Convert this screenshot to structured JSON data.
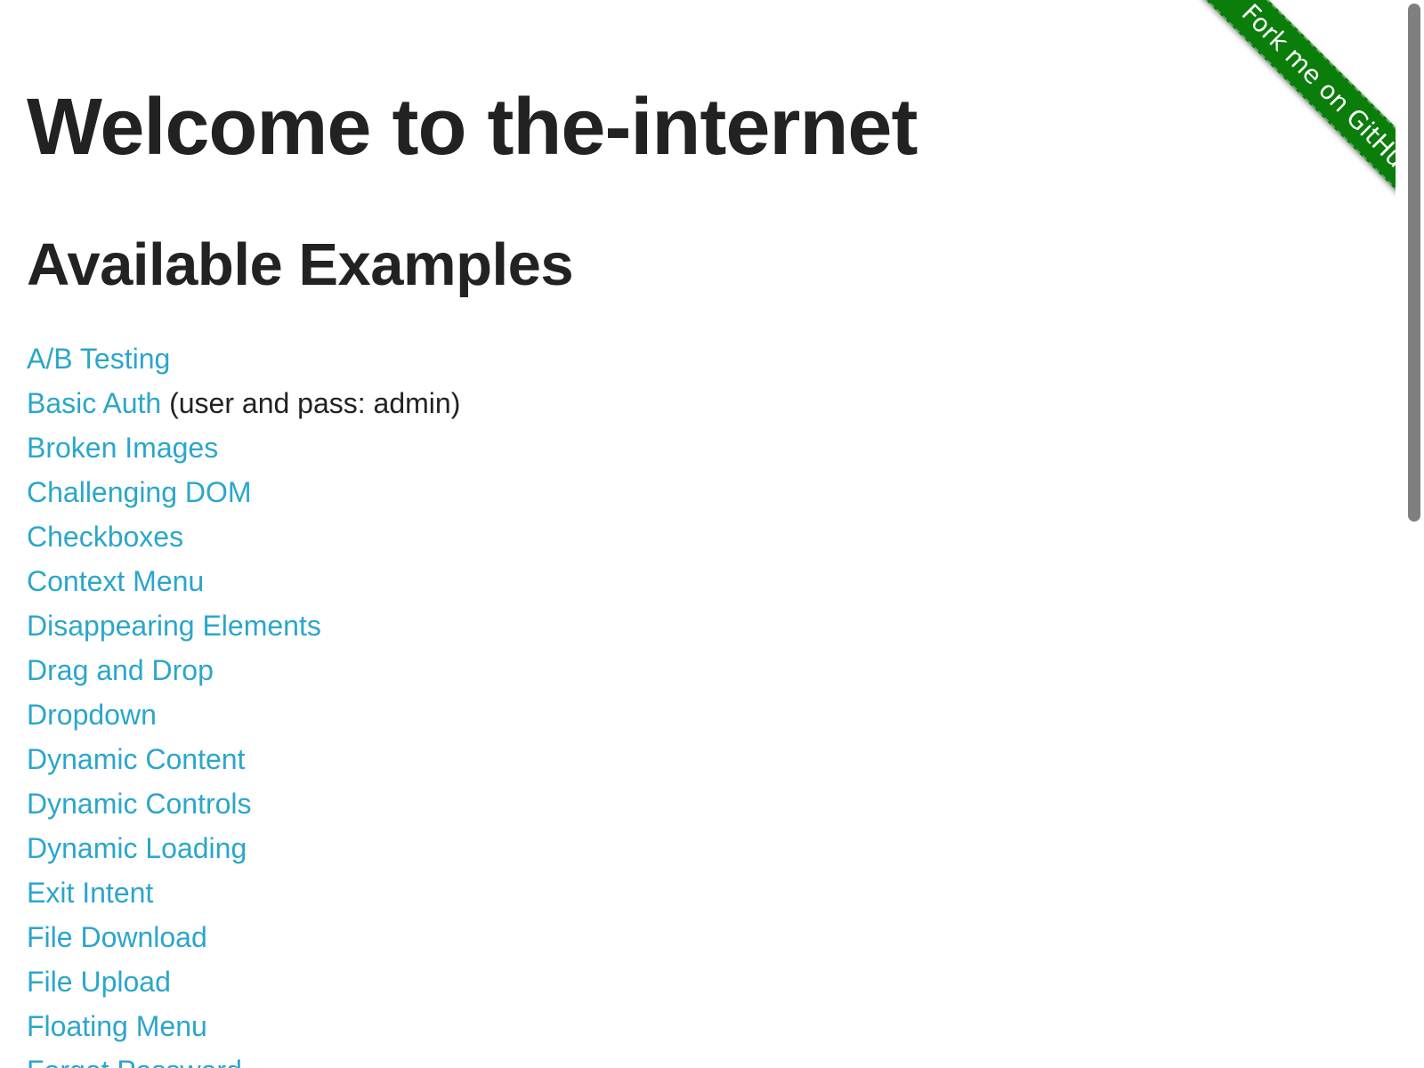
{
  "page": {
    "title": "Welcome to the-internet",
    "subtitle": "Available Examples"
  },
  "ribbon": {
    "label": "Fork me on GitHub"
  },
  "examples": [
    {
      "label": "A/B Testing",
      "note": ""
    },
    {
      "label": "Basic Auth",
      "note": "(user and pass: admin)"
    },
    {
      "label": "Broken Images",
      "note": ""
    },
    {
      "label": "Challenging DOM",
      "note": ""
    },
    {
      "label": "Checkboxes",
      "note": ""
    },
    {
      "label": "Context Menu",
      "note": ""
    },
    {
      "label": "Disappearing Elements",
      "note": ""
    },
    {
      "label": "Drag and Drop",
      "note": ""
    },
    {
      "label": "Dropdown",
      "note": ""
    },
    {
      "label": "Dynamic Content",
      "note": ""
    },
    {
      "label": "Dynamic Controls",
      "note": ""
    },
    {
      "label": "Dynamic Loading",
      "note": ""
    },
    {
      "label": "Exit Intent",
      "note": ""
    },
    {
      "label": "File Download",
      "note": ""
    },
    {
      "label": "File Upload",
      "note": ""
    },
    {
      "label": "Floating Menu",
      "note": ""
    },
    {
      "label": "Forgot Password",
      "note": ""
    }
  ],
  "colors": {
    "link": "#2ba6cb",
    "heading": "#222222",
    "ribbon": "#0a7d0a"
  }
}
